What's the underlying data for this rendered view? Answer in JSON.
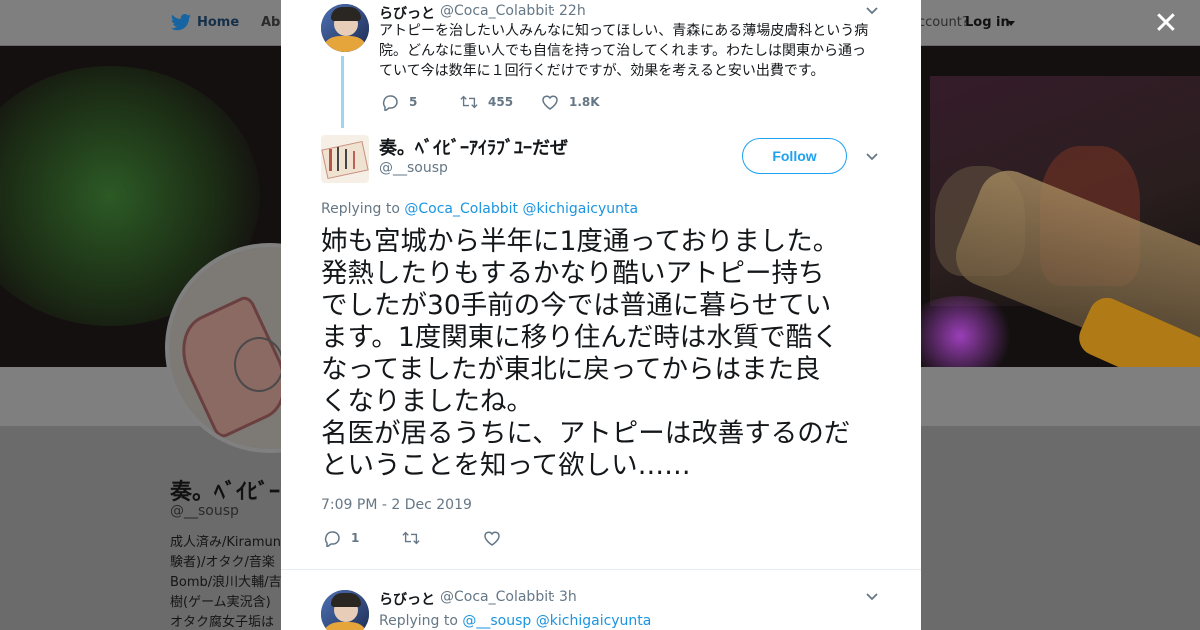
{
  "background": {
    "nav": {
      "home_label": "Home",
      "about_label": "Abo",
      "account_prompt": "ccount?",
      "login_label": "Log in"
    },
    "profile": {
      "name": "奏。ﾍﾞｲﾋﾞｰｱ",
      "handle": "@__sousp",
      "bio_lines": [
        "成人済み/Kiramun",
        "験者)/オタク/音楽",
        "Bomb/浪川大輔/吉",
        "樹(ゲーム実況含)",
        "オタク腐女子垢は"
      ]
    }
  },
  "modal": {
    "close_label": "✕",
    "parent_tweet": {
      "name": "らびっと",
      "handle": "@Coca_Colabbit",
      "time": "22h",
      "text_lines": [
        "アトピーを治したい人みんなに知ってほしい、青森にある薄場皮膚科という病",
        "院。どんなに重い人でも自信を持って治してくれます。わたしは関東から通っ",
        "ていて今は数年に１回行くだけですが、効果を考えると安い出費です。"
      ],
      "actions": {
        "replies": "5",
        "retweets": "455",
        "likes": "1.8K"
      }
    },
    "main_tweet": {
      "name": "奏。ﾍﾞｲﾋﾞｰｱｲﾗﾌﾞﾕｰだぜ",
      "handle": "@__sousp",
      "follow_label": "Follow",
      "replying_prefix": "Replying to",
      "replying_mentions": [
        "@Coca_Colabbit",
        "@kichigaicyunta"
      ],
      "text_lines": [
        "姉も宮城から半年に1度通っておりました。",
        "発熱したりもするかなり酷いアトピー持ち",
        "でしたが30手前の今では普通に暮らせてい",
        "ます。1度関東に移り住んだ時は水質で酷く",
        "なってましたが東北に戻ってからはまた良",
        "くなりましたね。",
        "名医が居るうちに、アトピーは改善するのだ",
        "ということを知って欲しい……"
      ],
      "timestamp": "7:09 PM - 2 Dec 2019",
      "actions": {
        "replies": "1"
      }
    },
    "reply_tweet": {
      "name": "らびっと",
      "handle": "@Coca_Colabbit",
      "time": "3h",
      "replying_prefix": "Replying to",
      "replying_mentions": [
        "@__sousp",
        "@kichigaicyunta"
      ]
    },
    "colors": {
      "link": "#1b95e0",
      "accent": "#1da1f2",
      "muted": "#657786",
      "thread": "#9fd3f2"
    }
  }
}
